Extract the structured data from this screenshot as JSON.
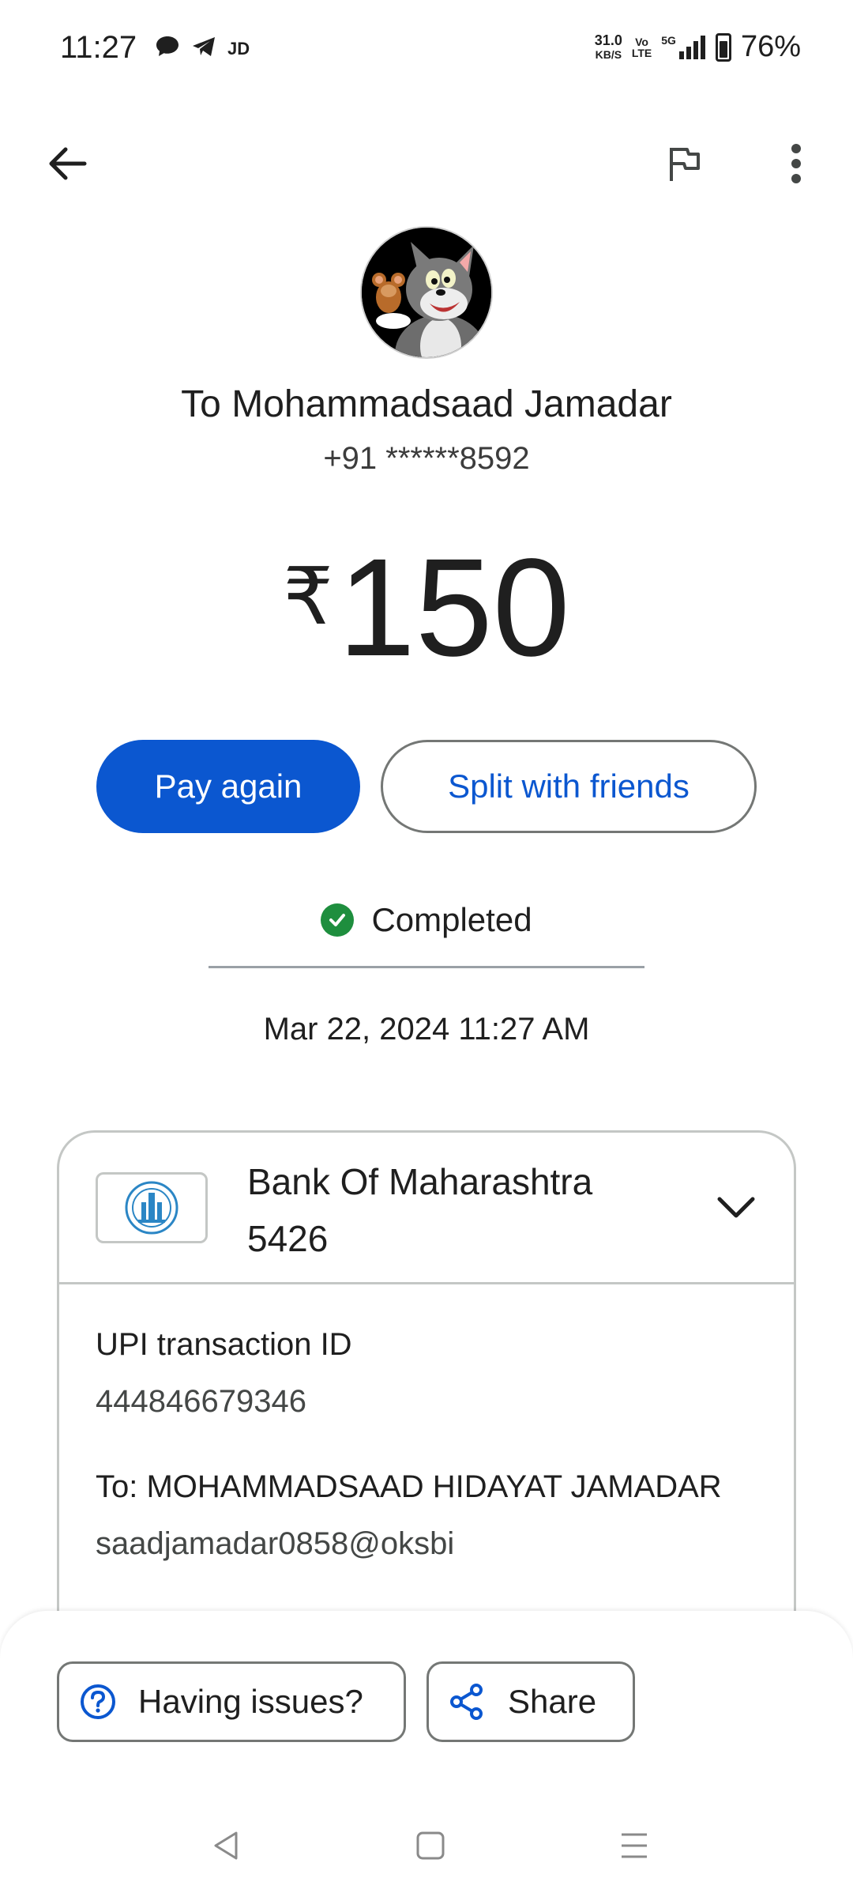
{
  "status_bar": {
    "time": "11:27",
    "jd_label": "JD",
    "net_speed_value": "31.0",
    "net_speed_unit": "KB/S",
    "volte_top": "Vo",
    "volte_bottom": "LTE",
    "network_type": "5G",
    "battery_percent": "76%",
    "icons": [
      "chat-bubble-icon",
      "telegram-icon",
      "signal-icon",
      "battery-icon"
    ]
  },
  "app_bar": {
    "icons": [
      "back-arrow-icon",
      "flag-icon",
      "more-vert-icon"
    ]
  },
  "recipient": {
    "name": "To Mohammadsaad Jamadar",
    "phone": "+91 ******8592"
  },
  "payment": {
    "currency_symbol": "₹",
    "amount": "150"
  },
  "actions": {
    "pay_again": "Pay again",
    "split": "Split with friends"
  },
  "transaction": {
    "status": "Completed",
    "datetime": "Mar 22, 2024 11:27 AM"
  },
  "bank": {
    "name": "Bank Of Maharashtra",
    "account": "5426"
  },
  "details": {
    "upi_label": "UPI transaction ID",
    "upi_id": "444846679346",
    "to_label": "To: MOHAMMADSAAD HIDAYAT JAMADAR",
    "to_vpa": "saadjamadar0858@oksbi"
  },
  "bottom_actions": {
    "issues": "Having issues?",
    "share": "Share"
  },
  "colors": {
    "accent": "#0b57d0",
    "success": "#1e8e3e",
    "outline": "#747775"
  }
}
